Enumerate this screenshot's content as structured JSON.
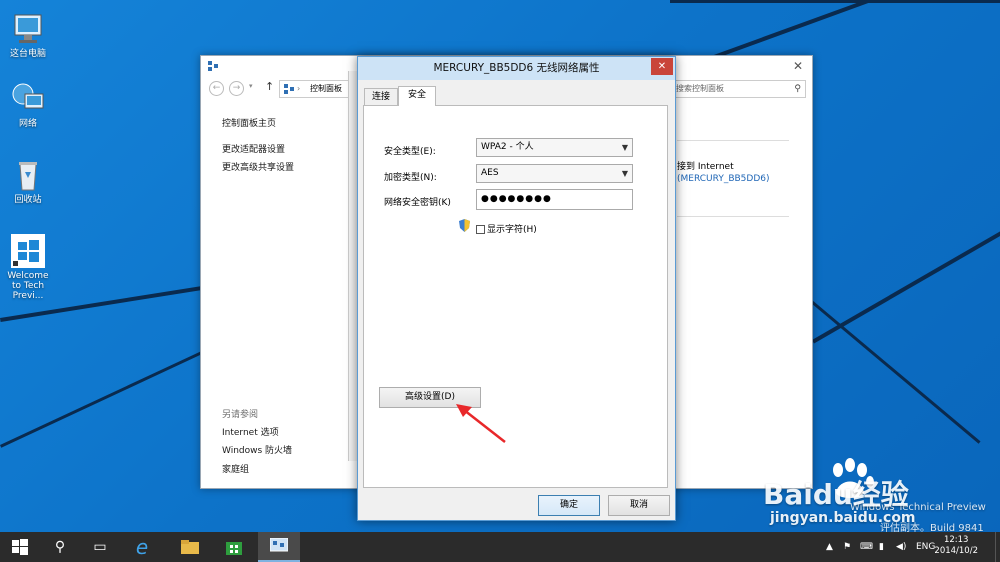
{
  "desktop": {
    "icons": [
      {
        "label": "这台电脑"
      },
      {
        "label": "网络"
      },
      {
        "label": "回收站"
      },
      {
        "label": "Welcome to Tech Previ..."
      }
    ],
    "watermark": {
      "line1": "Windows Technical Preview",
      "line2": "评估副本。Build 9841",
      "brand": "Baidu经验",
      "url": "jingyan.baidu.com"
    }
  },
  "control_panel": {
    "breadcrumb": "控制面板",
    "search_placeholder": "搜索控制面板",
    "sidebar": {
      "home": "控制面板主页",
      "links": [
        "更改适配器设置",
        "更改高级共享设置"
      ]
    },
    "see_also": {
      "heading": "另请参阅",
      "links": [
        "Internet 选项",
        "Windows 防火墙",
        "家庭组"
      ]
    },
    "right": {
      "access_text": "接到 Internet",
      "network_link": "(MERCURY_BB5DD6)"
    }
  },
  "dialog": {
    "title": "MERCURY_BB5DD6 无线网络属性",
    "close_label": "✕",
    "tabs": [
      {
        "label": "连接"
      },
      {
        "label": "安全"
      }
    ],
    "fields": {
      "security_type_label": "安全类型(E):",
      "security_type_value": "WPA2 - 个人",
      "encryption_type_label": "加密类型(N):",
      "encryption_type_value": "AES",
      "key_label": "网络安全密钥(K)",
      "key_value": "●●●●●●●●",
      "show_chars_label": "显示字符(H)"
    },
    "advanced_button": "高级设置(D)",
    "ok_button": "确定",
    "cancel_button": "取消"
  },
  "taskbar": {
    "lang": "ENG",
    "time": "12:13",
    "date": "2014/10/2"
  }
}
